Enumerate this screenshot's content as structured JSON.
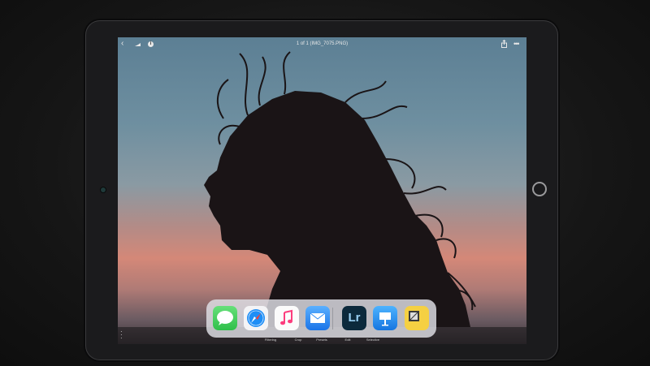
{
  "viewer": {
    "title": "1 of 1 (IMG_7075.PNG)",
    "back_glyph": "‹",
    "info_glyph": "i",
    "more_glyph": "•••",
    "icons": [
      "back-icon",
      "cloud-icon",
      "info-icon",
      "share-icon",
      "more-icon"
    ]
  },
  "actions": [
    "Filtering",
    "Crop",
    "Presets",
    "Edit",
    "Selective"
  ],
  "dock": {
    "apps": [
      "Messages",
      "Safari",
      "Music",
      "Mail",
      "Lightroom",
      "Keynote",
      "Notes"
    ],
    "lr_text": "Lr"
  },
  "colors": {
    "messages": "#4cd964",
    "safari": "#1e8ef6",
    "mail": "#2f8cf5",
    "lightroom": "#0c2a3c",
    "keynote": "#1d93f2",
    "notes": "#f5d042"
  }
}
